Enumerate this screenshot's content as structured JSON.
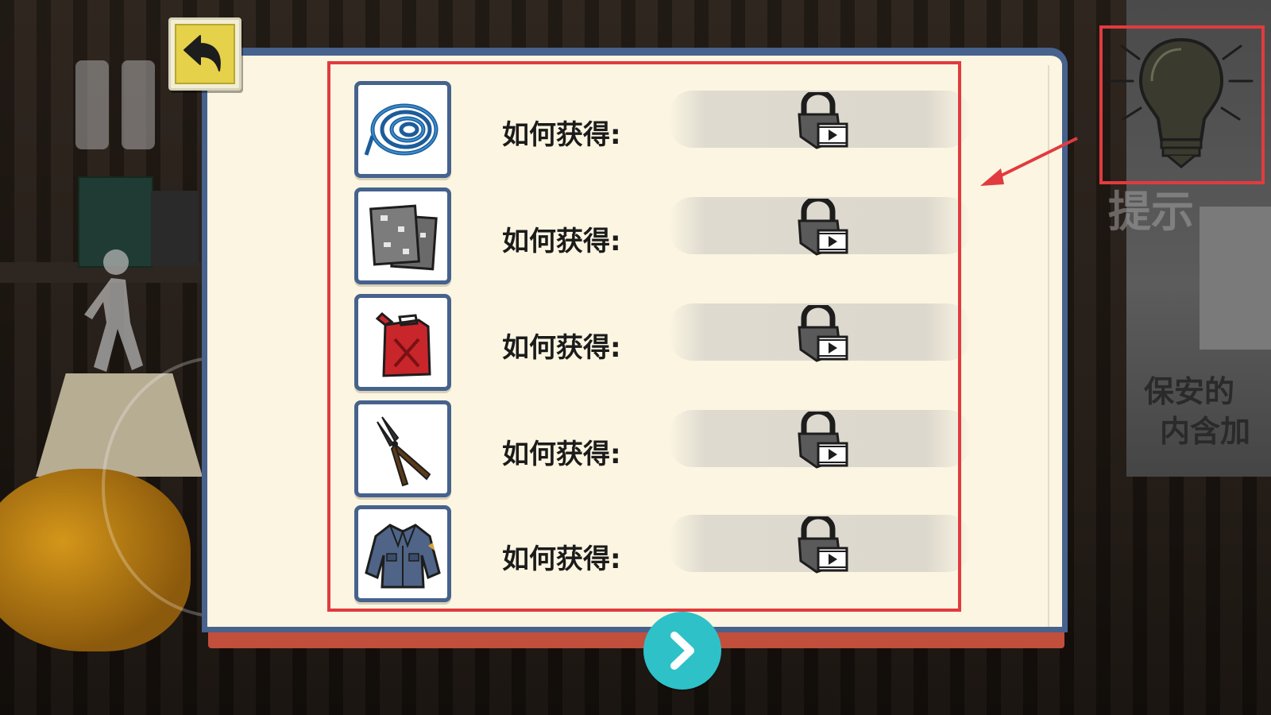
{
  "background": {
    "poster_lines": [
      "保安的",
      "内含加"
    ],
    "hint_label": "提示"
  },
  "panel": {
    "items": [
      {
        "name": "rope",
        "label": "如何获得:",
        "answer_locked": true
      },
      {
        "name": "paper",
        "label": "如何获得:",
        "answer_locked": true
      },
      {
        "name": "gas-can",
        "label": "如何获得:",
        "answer_locked": true
      },
      {
        "name": "pliers",
        "label": "如何获得:",
        "answer_locked": true
      },
      {
        "name": "uniform-jacket",
        "label": "如何获得:",
        "answer_locked": true
      }
    ]
  },
  "icons": {
    "back": "back-arrow-icon",
    "next": "chevron-right-icon",
    "hint": "lightbulb-icon",
    "pause": "pause-icon",
    "lock": "lock-video-icon"
  },
  "colors": {
    "accent_blue": "#46628d",
    "highlight_red": "#e13b3f",
    "next_teal": "#2ec1c8",
    "back_yellow": "#e5d14a",
    "page_cream": "#fbf5e1"
  }
}
